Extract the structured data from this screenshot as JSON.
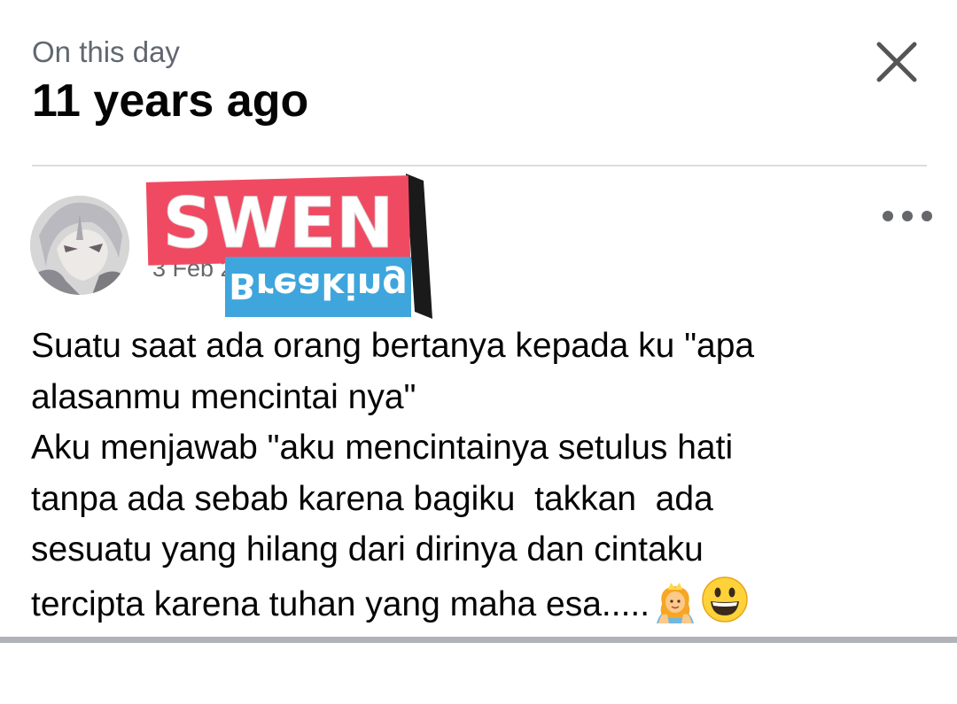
{
  "memory_header": {
    "subtitle": "On this day",
    "title": "11 years ago"
  },
  "post": {
    "author_name": "",
    "date": "3 Feb 2015",
    "lines": [
      "Suatu saat ada orang bertanya kepada ku \"apa",
      "alasanmu mencintai nya\"",
      "Aku menjawab \"aku mencintainya setulus hati",
      "tanpa ada sebab karena bagiku  takkan  ada",
      "sesuatu yang hilang dari dirinya dan cintaku",
      "tercipta karena tuhan yang maha esa....."
    ],
    "emojis": [
      "princess-emoji",
      "grinning-face-emoji"
    ]
  },
  "sticker": {
    "top_text": "SWEN",
    "bottom_text": "Breaking",
    "colors": {
      "pink": "#f04a63",
      "blue": "#3ea6dc",
      "black": "#1a1a1a"
    }
  },
  "icons": {
    "close": "close-icon",
    "more": "more-options-icon"
  },
  "colors": {
    "title": "#050505",
    "subtitle": "#606770",
    "divider": "#dadde1",
    "bottom_bar": "#b0b3b8"
  }
}
